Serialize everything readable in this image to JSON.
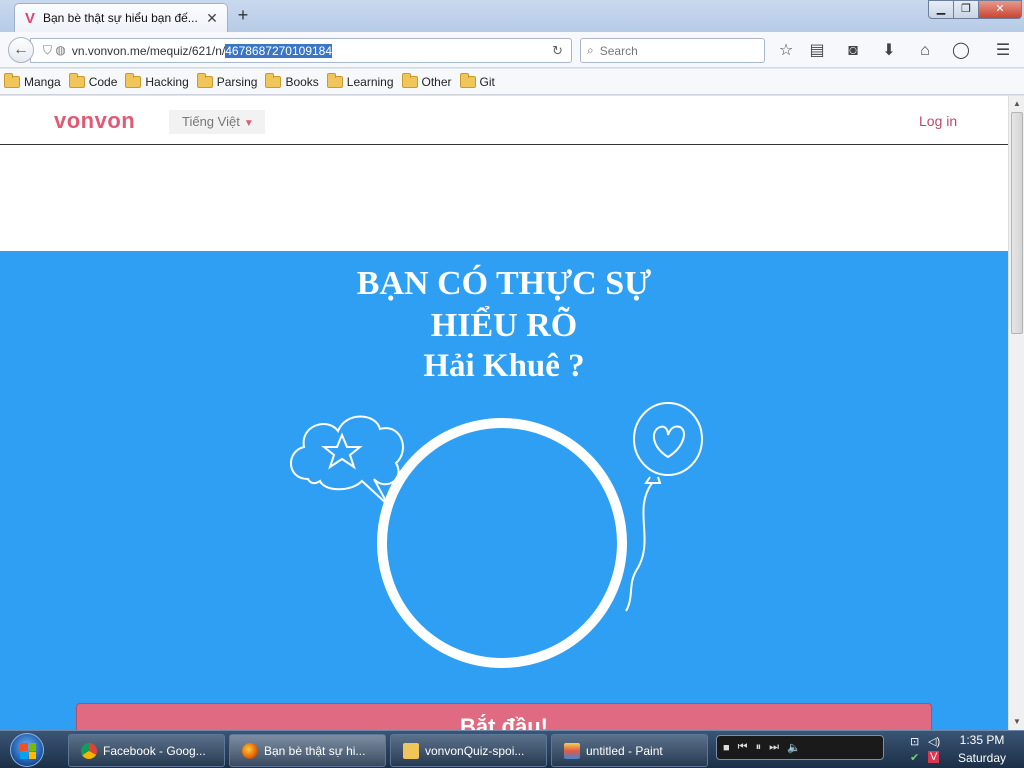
{
  "browser": {
    "tab_title": "Bạn bè thật sự hiểu bạn đế...",
    "tab_favicon": "V",
    "new_tab": "+",
    "url_prefix": "vn.vonvon.me/mequiz/621/n/",
    "url_selected": "4678687270109184",
    "search_placeholder": "Search",
    "bookmarks": [
      "Manga",
      "Code",
      "Hacking",
      "Parsing",
      "Books",
      "Learning",
      "Other",
      "Git"
    ]
  },
  "site": {
    "logo": "vonvon",
    "language": "Tiếng Việt",
    "login": "Log in",
    "title_line1": "BẠN CÓ THỰC SỰ",
    "title_line2": "HIỂU RÕ",
    "title_line3": "Hải Khuê ?",
    "start_button": "Bắt đầu!",
    "hero_color": "#2e9ff3",
    "accent_color": "#e05a73"
  },
  "taskbar": {
    "items": [
      {
        "label": "Facebook - Goog...",
        "icon": "chrome-icon"
      },
      {
        "label": "Bạn bè thật sự hi...",
        "icon": "firefox-icon"
      },
      {
        "label": "vonvonQuiz-spoi...",
        "icon": "folder-icon"
      },
      {
        "label": "untitled - Paint",
        "icon": "paint-icon"
      }
    ],
    "time": "1:35 PM",
    "day": "Saturday"
  }
}
